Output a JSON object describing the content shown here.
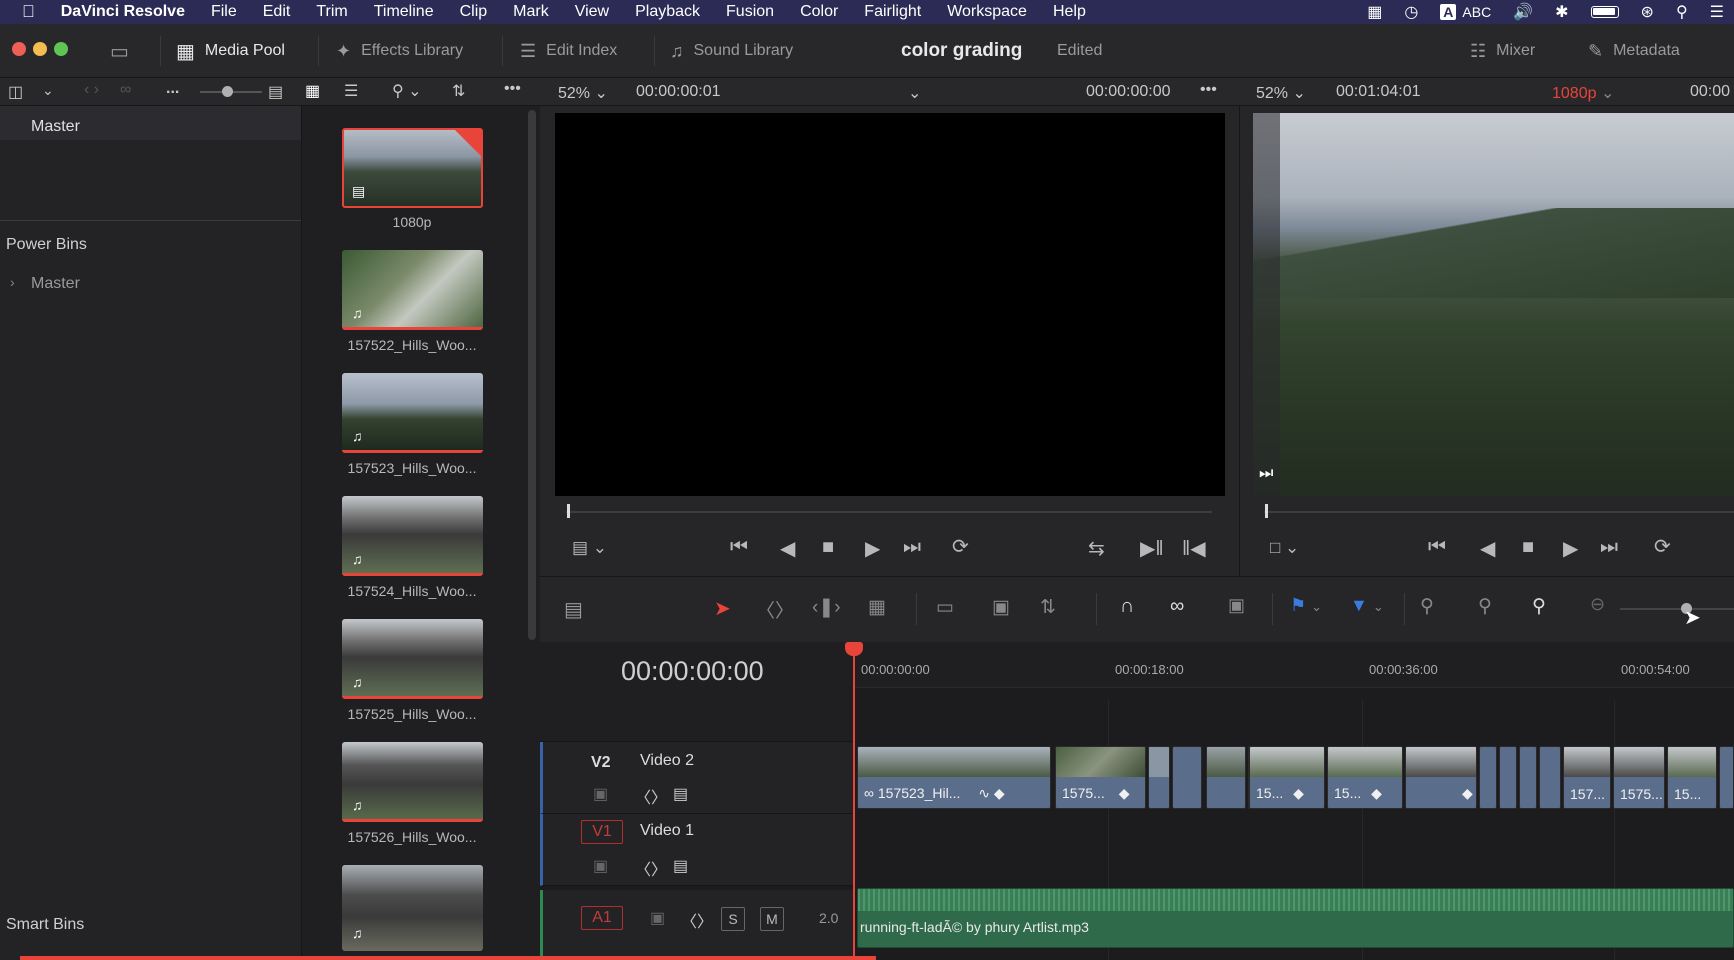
{
  "menubar": {
    "app": "DaVinci Resolve",
    "items": [
      "File",
      "Edit",
      "Trim",
      "Timeline",
      "Clip",
      "Mark",
      "View",
      "Playback",
      "Fusion",
      "Color",
      "Fairlight",
      "Workspace",
      "Help"
    ],
    "input_source": "ABC",
    "input_letter": "A"
  },
  "toolbar": {
    "media_pool": "Media Pool",
    "effects_library": "Effects Library",
    "edit_index": "Edit Index",
    "sound_library": "Sound Library",
    "project_title": "color grading",
    "project_status": "Edited",
    "mixer": "Mixer",
    "metadata": "Metadata"
  },
  "pool_header": {
    "more": "..."
  },
  "source_viewer": {
    "zoom": "52%",
    "timecode": "00:00:00:01",
    "timecode_right": "00:00:00:00"
  },
  "timeline_viewer": {
    "zoom": "52%",
    "duration": "00:01:04:01",
    "resolution": "1080p",
    "timecode": "00:00"
  },
  "bins": {
    "master": "Master",
    "power_bins": "Power Bins",
    "power_master": "Master",
    "smart_bins": "Smart Bins"
  },
  "media": [
    {
      "label": "1080p"
    },
    {
      "label": "157522_Hills_Woo..."
    },
    {
      "label": "157523_Hills_Woo..."
    },
    {
      "label": "157524_Hills_Woo..."
    },
    {
      "label": "157525_Hills_Woo..."
    },
    {
      "label": "157526_Hills_Woo..."
    }
  ],
  "timeline": {
    "timecode": "00:00:00:00",
    "ruler": [
      "00:00:00:00",
      "00:00:18:00",
      "00:00:36:00",
      "00:00:54:00"
    ],
    "tracks": {
      "v2": {
        "id": "V2",
        "name": "Video 2"
      },
      "v1": {
        "id": "V1",
        "name": "Video 1"
      },
      "a1": {
        "id": "A1",
        "solo": "S",
        "mute": "M",
        "level": "2.0"
      }
    },
    "clips": [
      "157523_Hil...",
      "1575...",
      "15...",
      "15...",
      "157...",
      "1575...",
      "15..."
    ],
    "audio_clip": "running-ft-ladÃ© by phury Artlist.mp3"
  },
  "colors": {
    "accent_red": "#e8443a",
    "clip_blue": "#5a6e8c",
    "audio_green": "#2f6b4a"
  }
}
